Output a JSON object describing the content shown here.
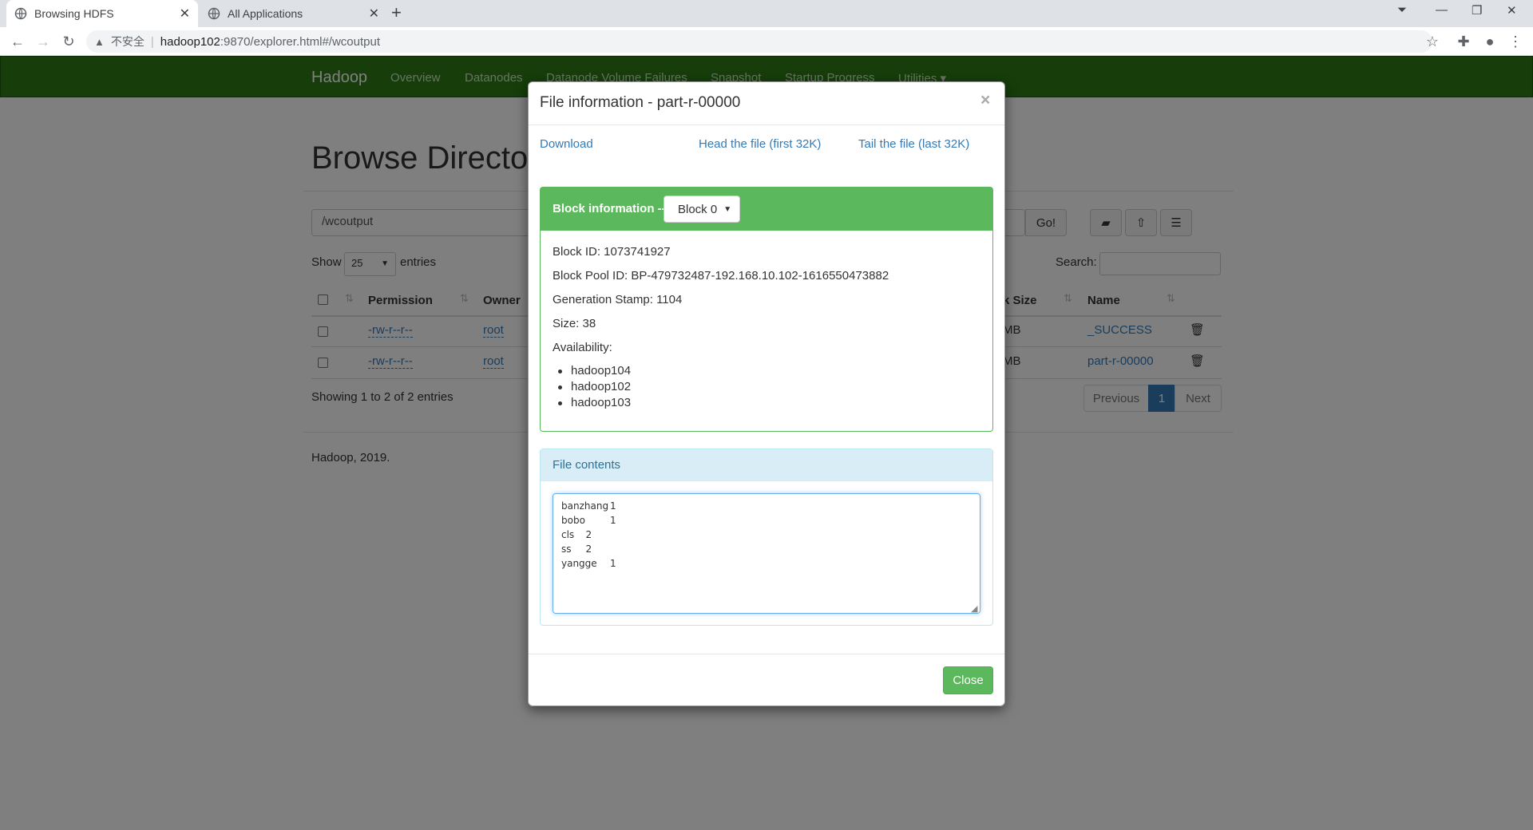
{
  "browser": {
    "tabs": [
      {
        "title": "Browsing HDFS"
      },
      {
        "title": "All Applications"
      }
    ],
    "address": {
      "security_warning": "不安全",
      "host": "hadoop102",
      "path": ":9870/explorer.html#/wcoutput"
    }
  },
  "navbar": {
    "brand": "Hadoop",
    "links": [
      "Overview",
      "Datanodes",
      "Datanode Volume Failures",
      "Snapshot",
      "Startup Progress",
      "Utilities ▾"
    ]
  },
  "page": {
    "heading": "Browse Director",
    "path_value": "/wcoutput",
    "go_label": "Go!",
    "show_label": "Show",
    "entries_value": "25",
    "entries_label": "entries",
    "search_label": "Search:",
    "columns": {
      "permission": "Permission",
      "owner": "Owner",
      "block_size": "k Size",
      "name": "Name"
    },
    "rows": [
      {
        "permission": "-rw-r--r--",
        "owner": "root",
        "block_size": "MB",
        "name": "_SUCCESS"
      },
      {
        "permission": "-rw-r--r--",
        "owner": "root",
        "block_size": "MB",
        "name": "part-r-00000"
      }
    ],
    "showing": "Showing 1 to 2 of 2 entries",
    "pagination": {
      "previous": "Previous",
      "current": "1",
      "next": "Next"
    },
    "footer": "Hadoop, 2019."
  },
  "modal": {
    "title": "File information - part-r-00000",
    "close_x": "×",
    "links": {
      "download": "Download",
      "head": "Head the file (first 32K)",
      "tail": "Tail the file (last 32K)"
    },
    "block_panel": {
      "title": "Block information --",
      "selected_block": "Block 0",
      "block_id": "Block ID: 1073741927",
      "pool_id": "Block Pool ID: BP-479732487-192.168.10.102-1616550473882",
      "generation": "Generation Stamp: 1104",
      "size": "Size: 38",
      "availability_label": "Availability:",
      "hosts": [
        "hadoop104",
        "hadoop102",
        "hadoop103"
      ]
    },
    "contents_panel": {
      "title": "File contents",
      "lines": [
        "banzhang\t1",
        "bobo\t1",
        "cls\t2",
        "ss\t2",
        "yangge\t1"
      ]
    },
    "close_button": "Close"
  }
}
